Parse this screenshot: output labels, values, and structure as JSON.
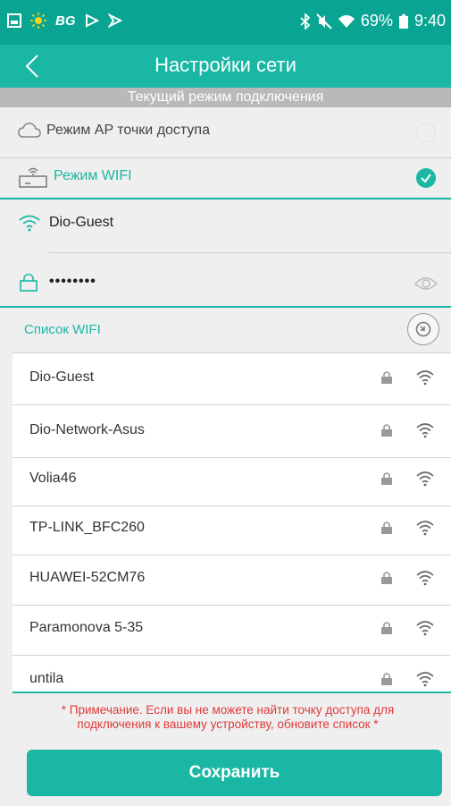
{
  "statusbar": {
    "carrier": "BG",
    "battery": "69%",
    "time": "9:40"
  },
  "header": {
    "title": "Настройки сети"
  },
  "section": {
    "title": "Текущий режим подключения"
  },
  "modes": {
    "ap_label": "Режим AP точки доступа",
    "wifi_label": "Режим WIFI",
    "selected": "wifi"
  },
  "network": {
    "ssid": "Dio-Guest",
    "password": "••••••••"
  },
  "wifi_list": {
    "title": "Список WIFI",
    "items": [
      {
        "name": "Dio-Guest"
      },
      {
        "name": "Dio-Network-Asus"
      },
      {
        "name": "Volia46"
      },
      {
        "name": "TP-LINK_BFC260"
      },
      {
        "name": "HUAWEI-52CM76"
      },
      {
        "name": "Paramonova 5-35"
      },
      {
        "name": "untila"
      }
    ]
  },
  "note": "* Примечание. Если вы не можете найти точку доступа для подключения к вашему устройству, обновите список *",
  "save_label": "Сохранить",
  "colors": {
    "accent": "#1ab7a4",
    "statusbar": "#0aa592",
    "note": "#e03a3a"
  }
}
